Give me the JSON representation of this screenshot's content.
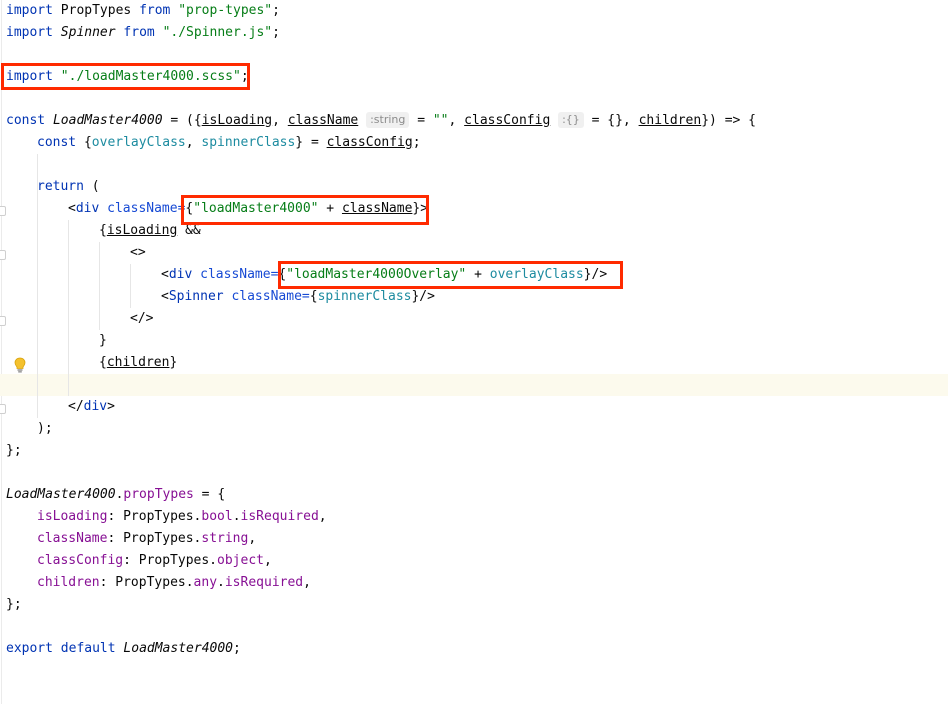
{
  "code": {
    "l1": {
      "kw": "import",
      "name": " PropTypes ",
      "from": "from",
      "str": "\"prop-types\"",
      "end": ";"
    },
    "l2": {
      "kw": "import",
      "name": "Spinner",
      "from": "from",
      "str": "\"./Spinner.js\"",
      "end": ";"
    },
    "l4": {
      "kw": "import",
      "str": "\"./loadMaster4000.scss\"",
      "end": ";"
    },
    "l6": {
      "const": "const",
      "name": "LoadMaster4000",
      "eq": " = ({",
      "p1": "isLoading",
      "c1": ", ",
      "p2": "className",
      "hint1": ":string",
      "eq2": " = ",
      "str": "\"\"",
      "c2": ", ",
      "p3": "classConfig",
      "hint2": ":{}",
      "eq3": " = {}, ",
      "p4": "children",
      "end": "}) => {"
    },
    "l7": {
      "const": "const",
      "open": " {",
      "a": "overlayClass",
      "comma": ", ",
      "b": "spinnerClass",
      "close": "} = ",
      "src": "classConfig",
      "end": ";"
    },
    "l9": {
      "kw": "return",
      "end": " ("
    },
    "l10": {
      "lt": "<",
      "tag": "div",
      "attr": " className",
      "eq": "=",
      "ob": "{",
      "str": "\"loadMaster4000\"",
      "plus": " + ",
      "ref": "className",
      "cb": "}",
      "gt": ">"
    },
    "l11": {
      "ob": "{",
      "ref": "isLoading",
      "end": " &&"
    },
    "l12": {
      "frag": "<>"
    },
    "l13": {
      "lt": "<",
      "tag": "div",
      "attr": " className",
      "eq": "=",
      "ob": "{",
      "str": "\"loadMaster4000Overlay\"",
      "plus": " + ",
      "ref": "overlayClass",
      "end": "}/>"
    },
    "l14": {
      "lt": "<",
      "tag": "Spinner",
      "attr": " className",
      "eq": "=",
      "ob": "{",
      "ref": "spinnerClass",
      "end": "}/>"
    },
    "l15": {
      "frag": "</>"
    },
    "l16": {
      "text": "}"
    },
    "l17": {
      "ob": "{",
      "ref": "children",
      "cb": "}"
    },
    "l19": {
      "lt": "</",
      "tag": "div",
      "gt": ">"
    },
    "l20": {
      "text": ");"
    },
    "l21": {
      "text": "};"
    },
    "l23": {
      "name": "LoadMaster4000",
      "dot": ".",
      "prop": "propTypes",
      "end": " = {"
    },
    "l24": {
      "key": "isLoading",
      "colon": ": PropTypes.",
      "t1": "bool",
      "dot": ".",
      "t2": "isRequired",
      "end": ","
    },
    "l25": {
      "key": "className",
      "colon": ": PropTypes.",
      "t1": "string",
      "end": ","
    },
    "l26": {
      "key": "classConfig",
      "colon": ": PropTypes.",
      "t1": "object",
      "end": ","
    },
    "l27": {
      "key": "children",
      "colon": ": PropTypes.",
      "t1": "any",
      "dot": ".",
      "t2": "isRequired",
      "end": ","
    },
    "l28": {
      "text": "};"
    },
    "l30": {
      "kw1": "export",
      "kw2": " default ",
      "name": "LoadMaster4000",
      "end": ";"
    }
  },
  "colors": {
    "keyword": "#0033b3",
    "string": "#067d17",
    "property": "#871094",
    "attribute": "#174ad4",
    "highlight_box": "#ff2a00",
    "current_line": "#fcfaed"
  },
  "icons": {
    "bulb": "intention-bulb-icon",
    "fold": "fold-marker-icon"
  }
}
